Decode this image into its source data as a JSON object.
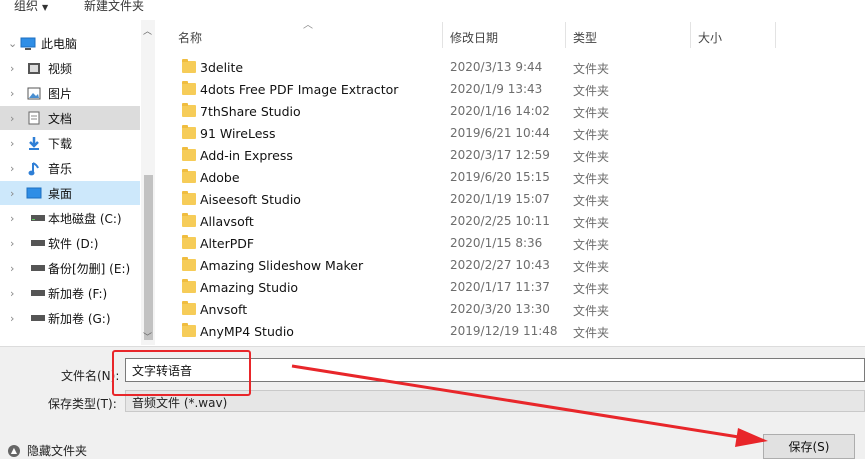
{
  "toolbar": {
    "organize": "组织",
    "new_folder": "新建文件夹"
  },
  "nav": {
    "items": [
      {
        "label": "此电脑",
        "icon": "computer-icon"
      },
      {
        "label": "视频",
        "icon": "video-folder-icon"
      },
      {
        "label": "图片",
        "icon": "pictures-folder-icon"
      },
      {
        "label": "文档",
        "icon": "documents-folder-icon"
      },
      {
        "label": "下载",
        "icon": "download-icon"
      },
      {
        "label": "音乐",
        "icon": "music-icon"
      },
      {
        "label": "桌面",
        "icon": "desktop-icon"
      },
      {
        "label": "本地磁盘 (C:)",
        "icon": "drive-icon"
      },
      {
        "label": "软件 (D:)",
        "icon": "drive-icon"
      },
      {
        "label": "备份[勿删] (E:)",
        "icon": "drive-icon"
      },
      {
        "label": "新加卷 (F:)",
        "icon": "drive-icon"
      },
      {
        "label": "新加卷 (G:)",
        "icon": "drive-icon"
      }
    ]
  },
  "columns": {
    "name": "名称",
    "date": "修改日期",
    "type": "类型",
    "size": "大小"
  },
  "files": [
    {
      "name": "3delite",
      "date": "2020/3/13 9:44",
      "type": "文件夹"
    },
    {
      "name": "4dots Free PDF Image Extractor",
      "date": "2020/1/9 13:43",
      "type": "文件夹"
    },
    {
      "name": "7thShare Studio",
      "date": "2020/1/16 14:02",
      "type": "文件夹"
    },
    {
      "name": "91 WireLess",
      "date": "2019/6/21 10:44",
      "type": "文件夹"
    },
    {
      "name": "Add-in Express",
      "date": "2020/3/17 12:59",
      "type": "文件夹"
    },
    {
      "name": "Adobe",
      "date": "2019/6/20 15:15",
      "type": "文件夹"
    },
    {
      "name": "Aiseesoft Studio",
      "date": "2020/1/19 15:07",
      "type": "文件夹"
    },
    {
      "name": "Allavsoft",
      "date": "2020/2/25 10:11",
      "type": "文件夹"
    },
    {
      "name": "AlterPDF",
      "date": "2020/1/15 8:36",
      "type": "文件夹"
    },
    {
      "name": "Amazing Slideshow Maker",
      "date": "2020/2/27 10:43",
      "type": "文件夹"
    },
    {
      "name": "Amazing Studio",
      "date": "2020/1/17 11:37",
      "type": "文件夹"
    },
    {
      "name": "Anvsoft",
      "date": "2020/3/20 13:30",
      "type": "文件夹"
    },
    {
      "name": "AnyMP4 Studio",
      "date": "2019/12/19 11:48",
      "type": "文件夹"
    }
  ],
  "bottom": {
    "filename_label": "文件名(N):",
    "filename_value": "文字转语音",
    "filetype_label": "保存类型(T):",
    "filetype_value": "音频文件 (*.wav)",
    "hide_folders": "隐藏文件夹",
    "save": "保存(S)"
  },
  "colors": {
    "selected_nav": "#dcdcdc",
    "selected_nav_desktop": "#cde8fb",
    "folder": "#f6cc58",
    "annotation": "#e8262a"
  }
}
